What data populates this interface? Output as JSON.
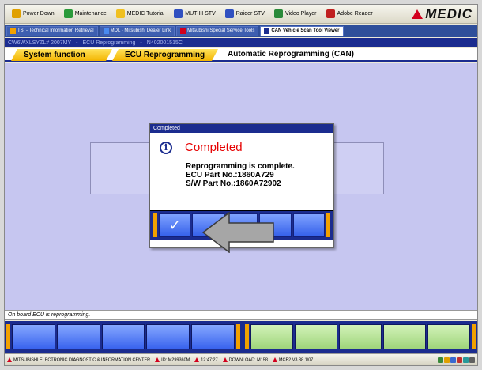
{
  "launcher": {
    "items": [
      {
        "label": "Power Down",
        "icon": "power-icon",
        "color": "#e0a000"
      },
      {
        "label": "Maintenance",
        "icon": "wrench-icon",
        "color": "#2a9a3a"
      },
      {
        "label": "MEDIC Tutorial",
        "icon": "tutorial-icon",
        "color": "#f0c020"
      },
      {
        "label": "MUT-III STV",
        "icon": "scan-tool-icon",
        "color": "#3050c0"
      },
      {
        "label": "Raider STV",
        "icon": "raider-icon",
        "color": "#3050c0"
      },
      {
        "label": "Video Player",
        "icon": "video-icon",
        "color": "#2a8a3a"
      },
      {
        "label": "Adobe Reader",
        "icon": "pdf-icon",
        "color": "#c02020"
      }
    ],
    "logo_text": "MEDIC"
  },
  "tabs": [
    {
      "label": "TSI - Technical Information Retrieval"
    },
    {
      "label": "MDL - Mitsubishi Dealer Link"
    },
    {
      "label": "Mitsubishi Special Service Tools"
    },
    {
      "label": "CAN Vehicle Scan Tool Viewer"
    }
  ],
  "breadcrumb": {
    "vin": "CW6WXLSYZL# 2007MY",
    "section": "ECU Reprogramming",
    "part": "N402001515C"
  },
  "function_tabs": {
    "system": "System function",
    "ecu": "ECU Reprogramming",
    "current": "Automatic Reprogramming (CAN)"
  },
  "dialog": {
    "title": "Completed",
    "heading": "Completed",
    "lines": [
      "Reprogramming is complete.",
      "ECU Part No.:1860A729",
      "S/W Part No.:1860A72902"
    ],
    "ok_symbol": "✓"
  },
  "status_message": "On board ECU is reprogramming.",
  "taskbar": {
    "items": [
      "MITSUBISHI ELECTRONIC DIAGNOSTIC & INFORMATION CENTER",
      "ID: M299360M",
      "12:47:27",
      "DOWNLOAD: M158",
      "MCP2 V3.38 1/07"
    ]
  },
  "colors": {
    "accent_blue": "#1b2c8f",
    "tab_yellow": "#f3b400",
    "alert_red": "#e60000",
    "work_area": "#c6c6f0"
  }
}
